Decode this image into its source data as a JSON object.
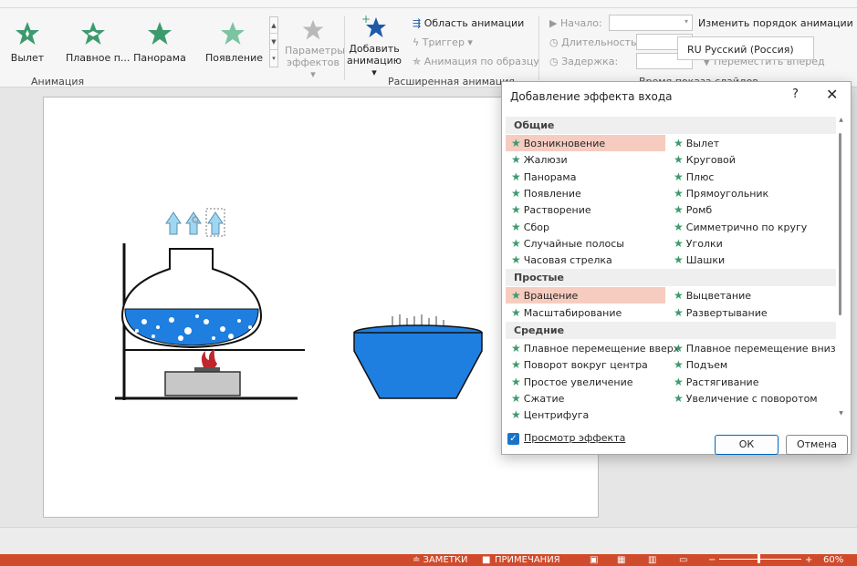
{
  "ribbon": {
    "gallery": [
      {
        "label": "Вылет"
      },
      {
        "label": "Плавное п..."
      },
      {
        "label": "Панорама"
      },
      {
        "label": "Появление"
      }
    ],
    "effect_options_line1": "Параметры",
    "effect_options_line2": "эффектов ▾",
    "add_animation_line1": "Добавить",
    "add_animation_line2": "анимацию ▾",
    "animation_pane": "Область анимации",
    "trigger": "Триггер ▾",
    "animation_painter": "Анимация по образцу",
    "start_label": "Начало:",
    "duration_label": "Длительность:",
    "delay_label": "Задержка:",
    "reorder_title": "Изменить порядок анимации",
    "move_later": "▼ Переместить вперед",
    "group_animation": "Анимация",
    "group_advanced": "Расширенная анимация",
    "group_timing": "Время показа слайдов"
  },
  "language_tooltip": "RU Русский (Россия)",
  "dialog": {
    "title": "Добавление эффекта входа",
    "help": "?",
    "close": "✕",
    "preview_label": "Просмотр эффекта",
    "ok": "ОК",
    "cancel": "Отмена",
    "sections": [
      {
        "title": "Общие",
        "left": [
          "Возникновение",
          "Жалюзи",
          "Панорама",
          "Появление",
          "Растворение",
          "Сбор",
          "Случайные полосы",
          "Часовая стрелка"
        ],
        "right": [
          "Вылет",
          "Круговой",
          "Плюс",
          "Прямоугольник",
          "Ромб",
          "Симметрично по кругу",
          "Уголки",
          "Шашки"
        ]
      },
      {
        "title": "Простые",
        "left": [
          "Вращение",
          "Масштабирование"
        ],
        "right": [
          "Выцветание",
          "Развертывание"
        ]
      },
      {
        "title": "Средние",
        "left": [
          "Плавное перемещение вверх",
          "Поворот вокруг центра",
          "Простое увеличение",
          "Сжатие",
          "Центрифуга"
        ],
        "right": [
          "Плавное перемещение вниз",
          "Подъем",
          "Растягивание",
          "Увеличение с поворотом"
        ]
      }
    ],
    "selected": [
      "Возникновение",
      "Вращение"
    ]
  },
  "statusbar": {
    "notes": "≐ ЗАМЕТКИ",
    "comments": "ПРИМЕЧАНИЯ",
    "zoom": "60%"
  },
  "colors": {
    "star_green": "#3d9a6e",
    "selection": "#f6ccc0",
    "status_bar": "#d04b2b",
    "checkbox": "#1a73c8",
    "liquid_blue": "#1e7fe0"
  }
}
